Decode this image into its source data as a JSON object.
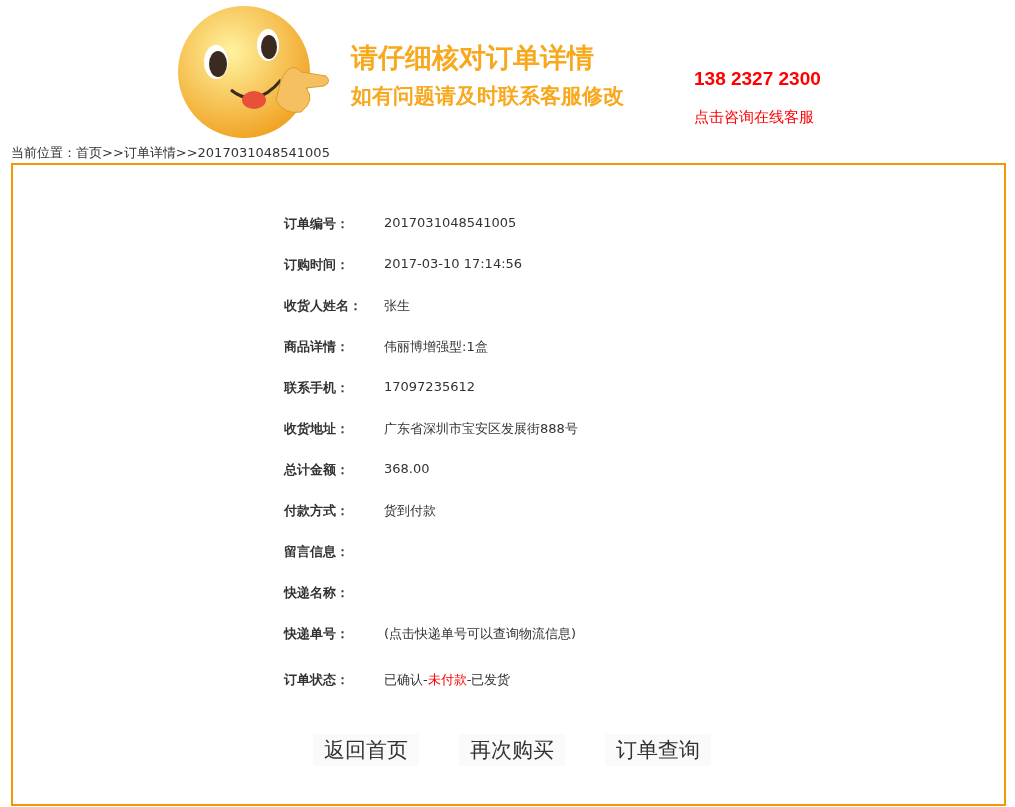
{
  "header": {
    "headline": "请仔细核对订单详情",
    "subline": "如有问题请及时联系客服修改",
    "phone": "138 2327 2300",
    "consult_link": "点击咨询在线客服"
  },
  "breadcrumb": "当前位置：首页>>订单详情>>2017031048541005",
  "fields": [
    {
      "label": "订单编号：",
      "value": "2017031048541005"
    },
    {
      "label": "订购时间：",
      "value": "2017-03-10 17:14:56"
    },
    {
      "label": "收货人姓名：",
      "value": "张生"
    },
    {
      "label": "商品详情：",
      "value": "伟丽博增强型:1盒"
    },
    {
      "label": "联系手机：",
      "value": "17097235612"
    },
    {
      "label": "收货地址：",
      "value": "广东省深圳市宝安区发展街888号"
    },
    {
      "label": "总计金额：",
      "value": "368.00"
    },
    {
      "label": "付款方式：",
      "value": "货到付款"
    },
    {
      "label": "留言信息："
    },
    {
      "label": "快递名称："
    },
    {
      "label": "快递单号：",
      "value": "(点击快递单号可以查询物流信息)"
    }
  ],
  "status": {
    "label": "订单状态：",
    "parts": [
      {
        "text": "已确认-",
        "color": "#333333"
      },
      {
        "text": "未付款",
        "color": "#ff0000"
      },
      {
        "text": "-已发货",
        "color": "#333333"
      }
    ]
  },
  "buttons": [
    "返回首页",
    "再次购买",
    "订单查询"
  ]
}
